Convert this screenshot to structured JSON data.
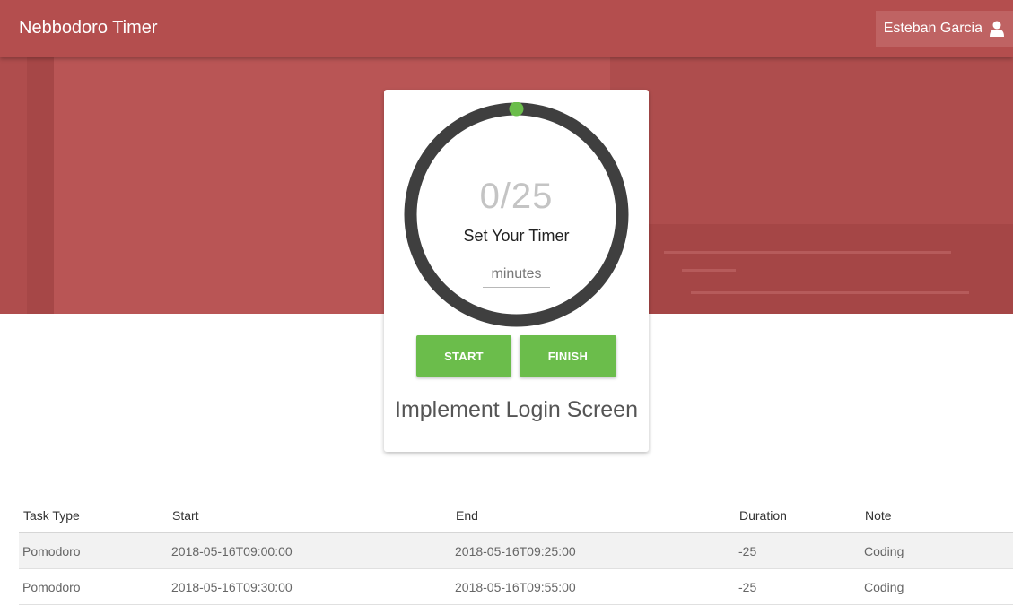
{
  "app": {
    "title": "Nebbodoro Timer",
    "user_name": "Esteban Garcia",
    "user_icon": "user-icon"
  },
  "timer": {
    "elapsed": 0,
    "total": 25,
    "display": "0/25",
    "heading": "Set Your Timer",
    "minutes_placeholder": "minutes",
    "minutes_value": "",
    "start_label": "START",
    "finish_label": "FINISH",
    "task_name": "Implement Login Screen",
    "progress_fraction": 0
  },
  "colors": {
    "brand_red": "#b95555",
    "accent_green": "#6bbd4b",
    "ring_dark": "#3f3f3f"
  },
  "history": {
    "columns": [
      "Task Type",
      "Start",
      "End",
      "Duration",
      "Note"
    ],
    "rows": [
      [
        "Pomodoro",
        "2018-05-16T09:00:00",
        "2018-05-16T09:25:00",
        "-25",
        "Coding"
      ],
      [
        "Pomodoro",
        "2018-05-16T09:30:00",
        "2018-05-16T09:55:00",
        "-25",
        "Coding"
      ]
    ]
  }
}
